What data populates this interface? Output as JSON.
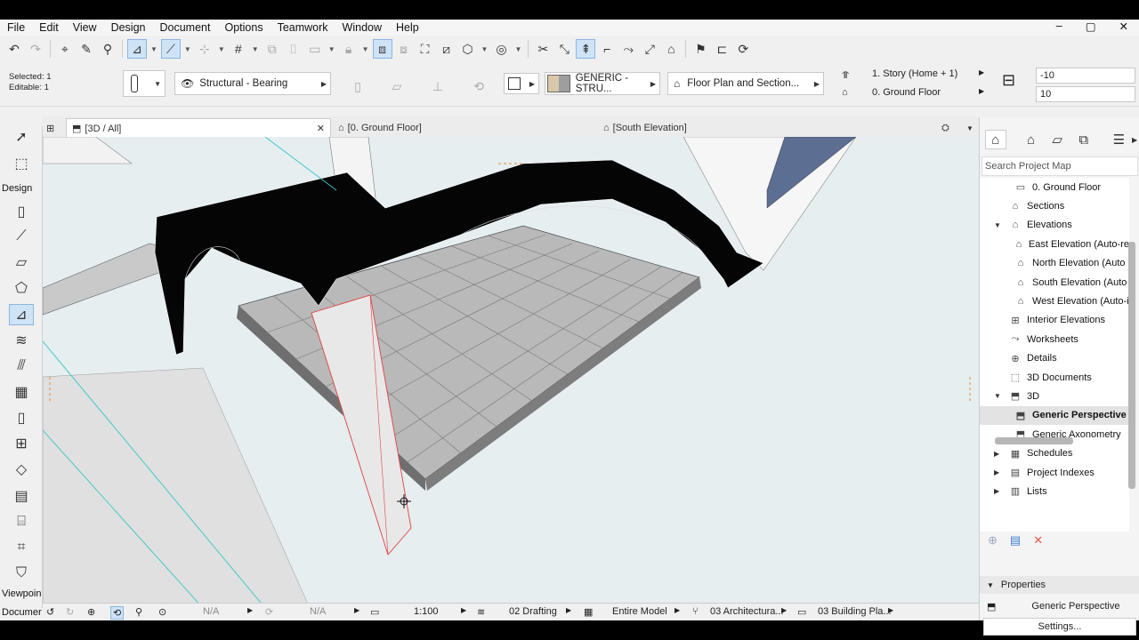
{
  "menu": [
    "File",
    "Edit",
    "View",
    "Design",
    "Document",
    "Options",
    "Teamwork",
    "Window",
    "Help"
  ],
  "window_controls": [
    "–",
    "▢",
    "✕"
  ],
  "info_box": {
    "selected": "Selected: 1",
    "editable": "Editable: 1",
    "structure": "Structural - Bearing",
    "material": "GENERIC - STRU...",
    "floor_plan_display": "Floor Plan and Section...",
    "home_story": "1. Story (Home + 1)",
    "ground_floor": "0. Ground Floor",
    "top_offset": "-10",
    "bottom_offset": "10"
  },
  "tabs": {
    "view3d": "[3D / All]",
    "ground_floor": "[0. Ground Floor]",
    "south_elevation": "[South Elevation]"
  },
  "toolbox": {
    "design_label": "Design",
    "viewpoint_label": "Viewpoin",
    "document_label": "Documer"
  },
  "status": {
    "na1": "N/A",
    "na2": "N/A",
    "scale": "1:100",
    "layer": "02 Drafting",
    "model": "Entire Model",
    "renovation": "03 Architectura...",
    "pen_set": "03 Building Pla..."
  },
  "navigator": {
    "search_placeholder": "Search Project Map",
    "items": [
      {
        "label": "0. Ground Floor",
        "level": 2,
        "expander": "",
        "icon": "floor-icon"
      },
      {
        "label": "Sections",
        "level": 1,
        "expander": "",
        "icon": "section-icon"
      },
      {
        "label": "Elevations",
        "level": 1,
        "expander": "v",
        "icon": "elevation-icon"
      },
      {
        "label": "East Elevation (Auto-re",
        "level": 2,
        "expander": "",
        "icon": "elevation-icon"
      },
      {
        "label": "North Elevation (Auto",
        "level": 2,
        "expander": "",
        "icon": "elevation-icon"
      },
      {
        "label": "South Elevation (Auto",
        "level": 2,
        "expander": "",
        "icon": "elevation-icon"
      },
      {
        "label": "West Elevation (Auto-i",
        "level": 2,
        "expander": "",
        "icon": "elevation-icon"
      },
      {
        "label": "Interior Elevations",
        "level": 1,
        "expander": "",
        "icon": "interior-elevation-icon"
      },
      {
        "label": "Worksheets",
        "level": 1,
        "expander": "",
        "icon": "worksheet-icon"
      },
      {
        "label": "Details",
        "level": 1,
        "expander": "",
        "icon": "detail-icon"
      },
      {
        "label": "3D Documents",
        "level": 1,
        "expander": "",
        "icon": "3d-document-icon"
      },
      {
        "label": "3D",
        "level": 1,
        "expander": "v",
        "icon": "3d-icon"
      },
      {
        "label": "Generic Perspective",
        "level": 2,
        "expander": "",
        "icon": "perspective-icon",
        "selected": true
      },
      {
        "label": "Generic Axonometry",
        "level": 2,
        "expander": "",
        "icon": "axonometry-icon"
      },
      {
        "label": "Schedules",
        "level": 1,
        "expander": ">",
        "icon": "schedule-icon"
      },
      {
        "label": "Project Indexes",
        "level": 1,
        "expander": ">",
        "icon": "index-icon"
      },
      {
        "label": "Lists",
        "level": 1,
        "expander": ">",
        "icon": "list-icon"
      }
    ]
  },
  "properties": {
    "header": "Properties",
    "current": "Generic Perspective",
    "settings_button": "Settings..."
  },
  "colors": {
    "selected_tool_bg": "#cfe3f7",
    "selected_outline": "#e04040",
    "guide_line": "#35c6c6",
    "editing_plane": "#e08a3c"
  }
}
